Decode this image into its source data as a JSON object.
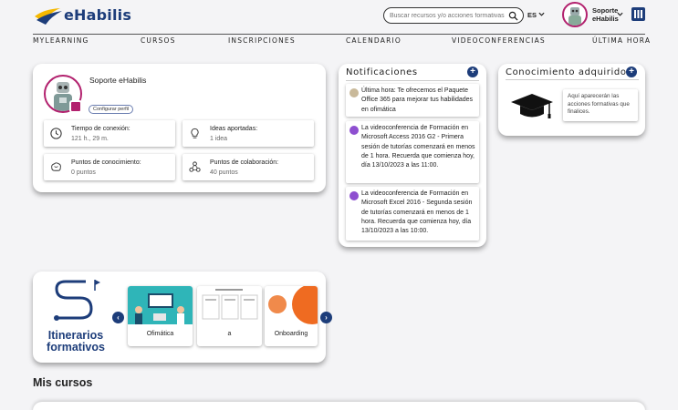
{
  "header": {
    "logo_text": "eHabilis",
    "search_placeholder": "Buscar recursos y/o acciones formativas",
    "language": "ES",
    "user_name": "Soporte eHabilis"
  },
  "nav": {
    "items": [
      "MYLEARNING",
      "CURSOS",
      "INSCRIPCIONES",
      "CALENDARIO",
      "VIDEOCONFERENCIAS",
      "ÚLTIMA HORA"
    ]
  },
  "profile": {
    "name": "Soporte eHabilis",
    "config_label": "Configurar perfil",
    "stats": [
      {
        "label": "Tiempo de conexión:",
        "value": "121 h., 29 m.",
        "icon": "clock-icon"
      },
      {
        "label": "Ideas aportadas:",
        "value": "1 idea",
        "icon": "lightbulb-icon"
      },
      {
        "label": "Puntos de conocimiento:",
        "value": "0 puntos",
        "icon": "brain-icon"
      },
      {
        "label": "Puntos de colaboración:",
        "value": "40 puntos",
        "icon": "collaboration-icon"
      }
    ]
  },
  "notifications": {
    "title": "Notificaciones",
    "items": [
      {
        "text": "Última hora: Te ofrecemos el Paquete Office 365 para mejorar tus habilidades en ofimática",
        "icon": "news-icon"
      },
      {
        "text": "La videoconferencia de Formación en Microsoft Access 2016 G2 - Primera sesión de tutorías comenzará en menos de 1 hora. Recuerda que comienza hoy, día 13/10/2023 a las 11:00.",
        "icon": "videoconference-icon"
      },
      {
        "text": "La videoconferencia de Formación en Microsoft Excel 2016 - Segunda sesión de tutorías comenzará en menos de 1 hora. Recuerda que comienza hoy, día 13/10/2023 a las 10:00.",
        "icon": "videoconference-icon"
      }
    ]
  },
  "knowledge": {
    "title": "Conocimiento adquirido",
    "empty_text": "Aquí aparecerán las acciones formativas que finalices."
  },
  "itineraries": {
    "title": "Itinerarios formativos",
    "courses": [
      {
        "label": "Ofimática"
      },
      {
        "label": "a"
      },
      {
        "label": "Onboarding"
      }
    ]
  },
  "my_courses": {
    "title": "Mis cursos"
  },
  "colors": {
    "brand": "#1d3d7a",
    "accent": "#b2216e",
    "gold": "#f5b800"
  }
}
